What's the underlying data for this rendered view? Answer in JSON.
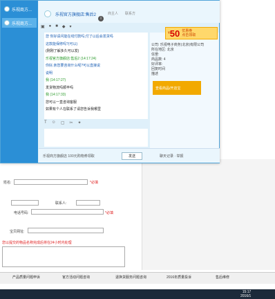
{
  "sidebar": {
    "items": [
      {
        "label": "乐视商方..."
      },
      {
        "label": "乐视商方..."
      }
    ]
  },
  "header": {
    "title": "乐视官方旗舰店:售后2",
    "tag": "商主人",
    "tag2": "联系方"
  },
  "promo": {
    "amount": "50",
    "line1": "优惠券",
    "line2": "点击领取"
  },
  "chat": {
    "messages": [
      {
        "name": "您",
        "text": "你好请问能在线付款吗,付了以后会发货吗",
        "color": "blue"
      },
      {
        "name": "",
        "text": "这款能保修吗?(可以)",
        "color": "blue"
      },
      {
        "name": "",
        "text": "(刚刚了解多久可以发)",
        "color": "text"
      },
      {
        "name": "乐视官方旗舰店:售后2",
        "text": "(14:17:24)",
        "color": "green"
      },
      {
        "name": "",
        "text": "你好,亲您要咨询什么呢?可以直接说",
        "color": "blue"
      },
      {
        "name": "",
        "text": "说明",
        "color": "blue"
      },
      {
        "name": "我",
        "text": "(14:17:27)",
        "color": "green"
      },
      {
        "name": "",
        "text": "发货物流吗顺丰吗",
        "color": "text"
      },
      {
        "name": "我",
        "text": "(14:17:33)",
        "color": "green"
      },
      {
        "name": "",
        "text": "您可以一直咨询客服",
        "color": "text"
      },
      {
        "name": "",
        "text": "如果有个人在联系了请您告诉我哪里",
        "color": "text"
      }
    ]
  },
  "right": {
    "lines": [
      "公司: 乐视电子商务(北京)有限公司",
      "所在地区: 北京",
      "信誉:",
      "商品数: 4",
      "好评率:",
      "回复时间",
      "描述"
    ],
    "banner": "查看商品/开店宝"
  },
  "footer": {
    "hint": "乐视商方旗舰店 100元购物券领取",
    "send": "发送",
    "right_link": "聊天记录 · 举报"
  },
  "form": {
    "name_label": "姓名:",
    "phone_label": "电话号码:",
    "field_a": "地址:",
    "field_b": "联系人:",
    "field_c": "宝贝网址:",
    "required": "*必填",
    "note": "您以提交的物品名称完成后将在24小时内处理"
  },
  "tabs": [
    {
      "label": "产品质量问题申诉"
    },
    {
      "label": "官方活动问题咨询"
    },
    {
      "label": "退换货服务问题咨询"
    },
    {
      "label": "2016年质量投诉"
    },
    {
      "label": "售后维修"
    }
  ],
  "clock": {
    "time": "15:17",
    "date": "2016/1"
  }
}
